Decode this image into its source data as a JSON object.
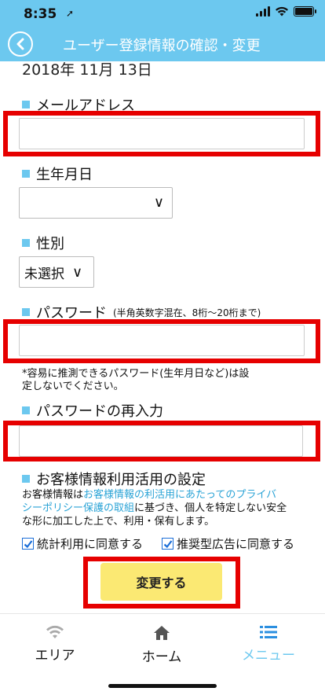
{
  "status_bar": {
    "time": "8:35",
    "location_glyph": "➚"
  },
  "header": {
    "title": "ユーザー登録情報の確認・変更",
    "back_icon": "chevron-left-icon"
  },
  "form": {
    "date_value": "2018年 11月 13日",
    "email": {
      "label": "メールアドレス",
      "value": ""
    },
    "birthday": {
      "label": "生年月日",
      "value": "",
      "chevron": "∨"
    },
    "gender": {
      "label": "性別",
      "value": "未選択",
      "chevron": "∨"
    },
    "password": {
      "label": "パスワード",
      "hint": "(半角英数字混在、8桁〜20桁まで)",
      "value": ""
    },
    "password_note_line1": "*容易に推測できるパスワード(生年月日など)は設",
    "password_note_line2": "定しないでください。",
    "password_confirm": {
      "label": "パスワードの再入力",
      "value": ""
    },
    "customer_info": {
      "label": "お客様情報利用活用の設定",
      "text_before_link": "お客様情報は",
      "link_line1": "お客様情報の利活用にあたってのプライバ",
      "link_line2": "シーポリシー保護の取組",
      "text_after_line2": "に基づき、個人を特定しない安全",
      "text_line3": "な形に加工した上で、利用・保有します。"
    },
    "consent_stats": {
      "label": "統計利用に同意する",
      "checked": true
    },
    "consent_ads": {
      "label": "推奨型広告に同意する",
      "checked": true
    },
    "submit_label": "変更する"
  },
  "tab_bar": {
    "tabs": [
      {
        "label": "エリア",
        "icon": "wifi-icon",
        "active": false
      },
      {
        "label": "ホーム",
        "icon": "home-icon",
        "active": false
      },
      {
        "label": "メニュー",
        "icon": "menu-list-icon",
        "active": true
      }
    ]
  },
  "colors": {
    "header_bg": "#6cc8ef",
    "highlight_red": "#e60000",
    "button_yellow": "#fbe973",
    "link_blue": "#2aa3d6",
    "tab_active": "#6cc8ef",
    "tab_inactive": "#111111"
  }
}
